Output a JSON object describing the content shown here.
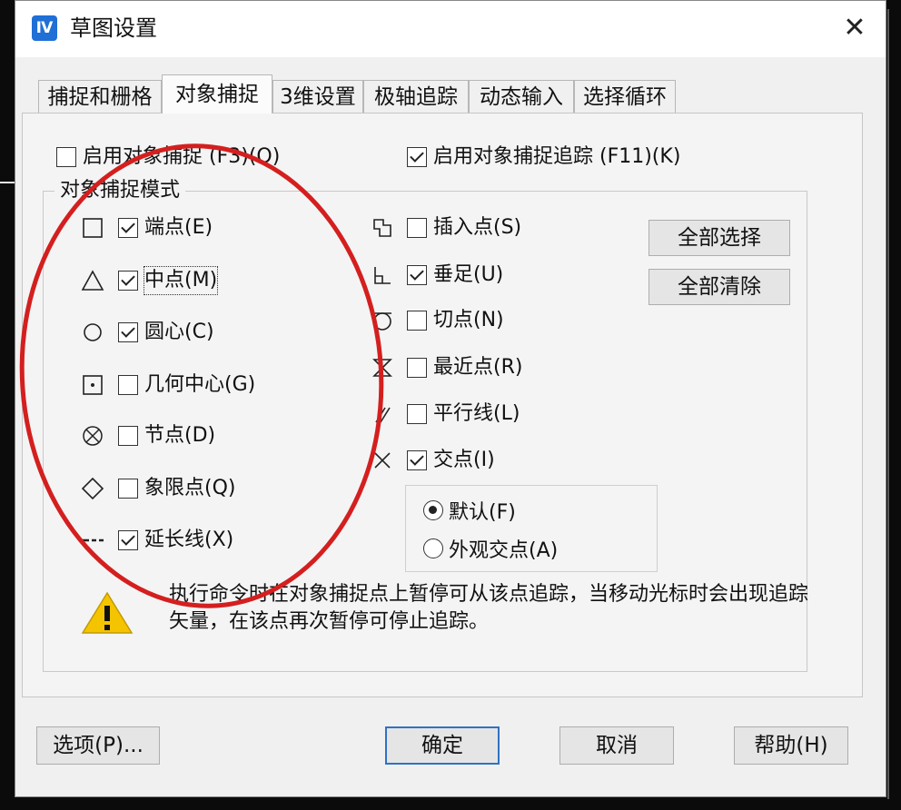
{
  "window": {
    "title": "草图设置"
  },
  "tabs": [
    "捕捉和栅格",
    "对象捕捉",
    "3维设置",
    "极轴追踪",
    "动态输入",
    "选择循环"
  ],
  "top_options": {
    "enable_osnap": {
      "label": "启用对象捕捉 (F3)(O)",
      "checked": false
    },
    "enable_tracking": {
      "label": "启用对象捕捉追踪 (F11)(K)",
      "checked": true
    }
  },
  "group_title": "对象捕捉模式",
  "left_modes": [
    {
      "label": "端点(E)",
      "checked": true,
      "symbol": "square"
    },
    {
      "label": "中点(M)",
      "checked": true,
      "symbol": "triangle"
    },
    {
      "label": "圆心(C)",
      "checked": true,
      "symbol": "circle"
    },
    {
      "label": "几何中心(G)",
      "checked": false,
      "symbol": "square-dot"
    },
    {
      "label": "节点(D)",
      "checked": false,
      "symbol": "circle-x"
    },
    {
      "label": "象限点(Q)",
      "checked": false,
      "symbol": "diamond"
    },
    {
      "label": "延长线(X)",
      "checked": true,
      "symbol": "dashes"
    }
  ],
  "right_modes": [
    {
      "label": "插入点(S)",
      "checked": false,
      "symbol": "insert"
    },
    {
      "label": "垂足(U)",
      "checked": true,
      "symbol": "perpendicular"
    },
    {
      "label": "切点(N)",
      "checked": false,
      "symbol": "tangent"
    },
    {
      "label": "最近点(R)",
      "checked": false,
      "symbol": "hourglass"
    },
    {
      "label": "平行线(L)",
      "checked": false,
      "symbol": "parallel"
    },
    {
      "label": "交点(I)",
      "checked": true,
      "symbol": "x-mark"
    }
  ],
  "intersection_radios": [
    {
      "label": "默认(F)",
      "selected": true
    },
    {
      "label": "外观交点(A)",
      "selected": false
    }
  ],
  "select_all": "全部选择",
  "clear_all": "全部清除",
  "note": "执行命令时在对象捕捉点上暂停可从该点追踪，当移动光标时会出现追踪矢量，在该点再次暂停可停止追踪。",
  "footer": {
    "options": "选项(P)...",
    "ok": "确定",
    "cancel": "取消",
    "help": "帮助(H)"
  },
  "colors": {
    "annotation_ellipse": "#d41f1f",
    "warning": "#f5c400",
    "accent": "#2f72c4"
  }
}
